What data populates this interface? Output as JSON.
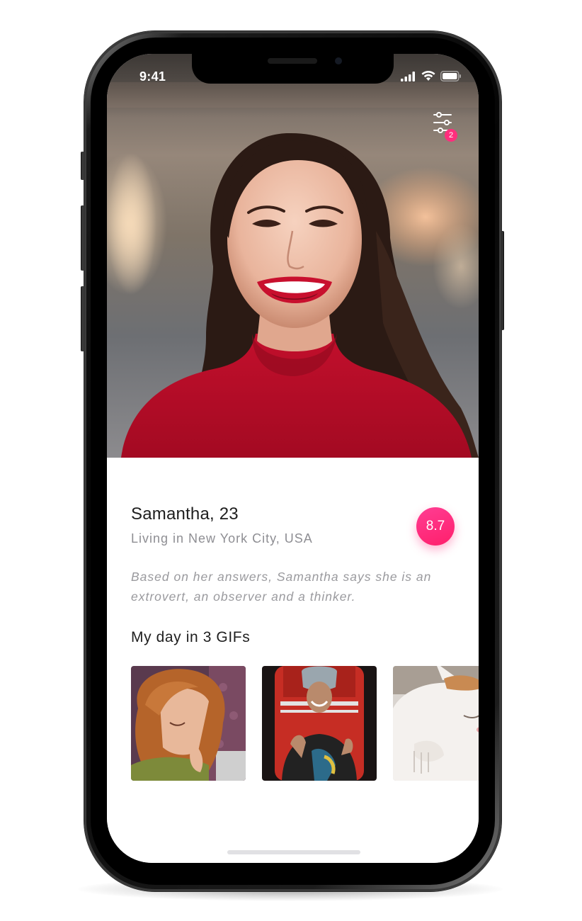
{
  "status_bar": {
    "time": "9:41"
  },
  "filter": {
    "badge_count": "2"
  },
  "profile": {
    "name_age": "Samantha, 23",
    "location": "Living in New York City, USA",
    "score": "8.7",
    "bio": "Based on her answers, Samantha says she is an extrovert, an observer and a thinker."
  },
  "gifs": {
    "title": "My day in 3 GIFs",
    "items": [
      {
        "name": "gif-tired-cartoon-girl"
      },
      {
        "name": "gif-laughing-woman-red-chair"
      },
      {
        "name": "gif-sleeping-cat"
      }
    ]
  },
  "colors": {
    "accent": "#ff2e7d",
    "text_primary": "#1e1e1e",
    "text_secondary": "#8e8e93"
  }
}
